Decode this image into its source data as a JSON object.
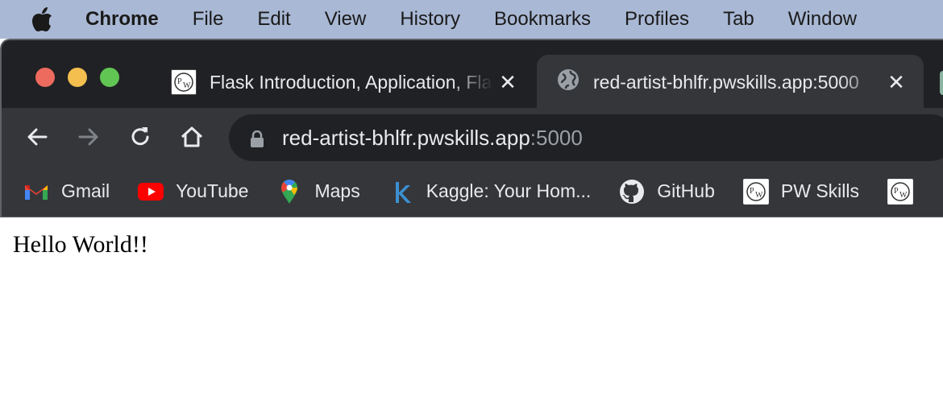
{
  "menubar": {
    "app_name": "Chrome",
    "items": [
      "File",
      "Edit",
      "View",
      "History",
      "Bookmarks",
      "Profiles",
      "Tab",
      "Window"
    ]
  },
  "tabs": [
    {
      "title": "Flask Introduction, Application, Flask Tutorial",
      "icon": "pw-logo-icon",
      "active": false
    },
    {
      "title": "red-artist-bhlfr.pwskills.app:5000",
      "icon": "globe-icon",
      "active": true
    }
  ],
  "omnibox": {
    "host": "red-artist-bhlfr.pwskills.app",
    "port": ":5000"
  },
  "bookmarks": [
    {
      "label": "Gmail",
      "icon": "gmail-icon"
    },
    {
      "label": "YouTube",
      "icon": "youtube-icon"
    },
    {
      "label": "Maps",
      "icon": "maps-icon"
    },
    {
      "label": "Kaggle: Your Hom...",
      "icon": "kaggle-icon"
    },
    {
      "label": "GitHub",
      "icon": "github-icon"
    },
    {
      "label": "PW Skills",
      "icon": "pw-logo-icon"
    }
  ],
  "page": {
    "text": "Hello World!!"
  },
  "colors": {
    "menubar": "#a9b8d4",
    "tabstrip": "#202124",
    "toolbar": "#35363a",
    "omnibox": "#202124"
  }
}
